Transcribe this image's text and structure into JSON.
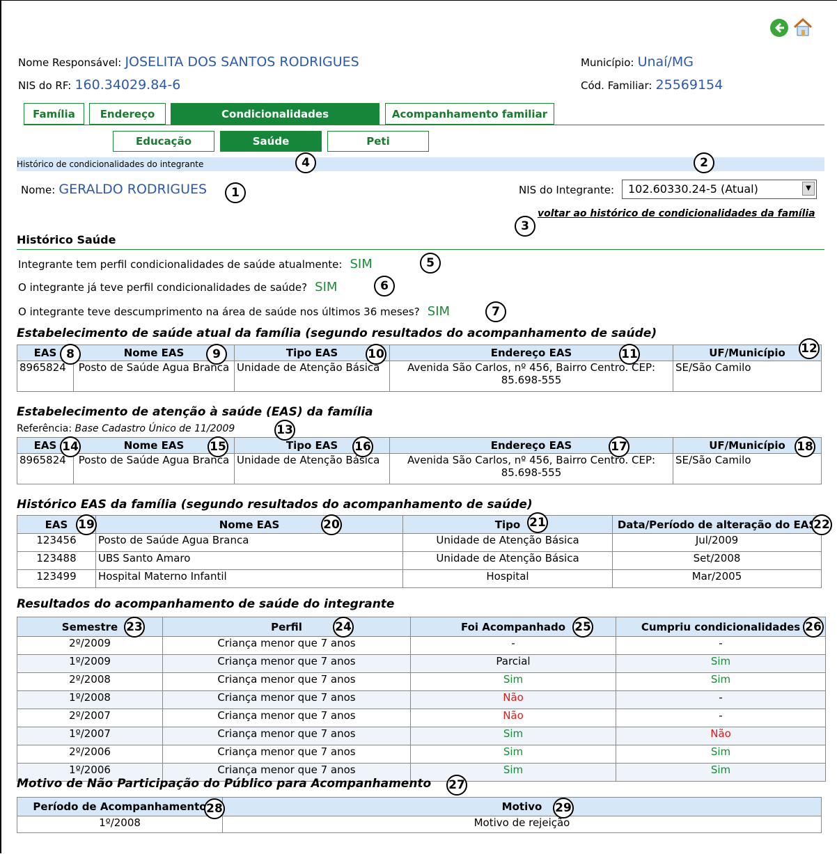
{
  "header": {
    "responsavel_label": "Nome Responsável:",
    "responsavel_value": "JOSELITA DOS SANTOS RODRIGUES",
    "nis_rf_label": "NIS do RF:",
    "nis_rf_value": "160.34029.84-6",
    "municipio_label": "Município:",
    "municipio_value": "Unaí/MG",
    "cod_familiar_label": "Cód. Familiar:",
    "cod_familiar_value": "25569154",
    "back_icon": "back-arrow-icon",
    "home_icon": "home-icon"
  },
  "tabs": [
    "Família",
    "Endereço",
    "Condicionalidades",
    "Acompanhamento familiar"
  ],
  "subtabs": [
    "Educação",
    "Saúde",
    "Peti"
  ],
  "section_bar": "Histórico de condicionalidades do integrante",
  "integrante": {
    "nome_label": "Nome:",
    "nome_value": "GERALDO RODRIGUES",
    "nis_label": "NIS do Integrante:",
    "nis_selected": "102.60330.24-5 (Atual)",
    "voltar_link": "voltar ao histórico de condicionalidades da família"
  },
  "historico": {
    "title": "Histórico Saúde",
    "q1": "Integrante tem perfil condicionalidades de saúde atualmente:",
    "a1": "SIM",
    "q2": "O integrante já teve perfil condicionalidades de saúde?",
    "a2": "SIM",
    "q3": "O integrante teve descumprimento na área de saúde nos últimos 36 meses?",
    "a3": "SIM"
  },
  "est_atual": {
    "title": "Estabelecimento de saúde atual da família (segundo resultados do acompanhamento de saúde)",
    "headers": [
      "EAS",
      "Nome EAS",
      "Tipo EAS",
      "Endereço EAS",
      "UF/Município"
    ],
    "row": [
      "8965824",
      "Posto de Saúde Agua Branca",
      "Unidade de Atenção Básica",
      "Avenida São Carlos, nº 456, Bairro Centro. CEP: 85.698-555",
      "SE/São Camilo"
    ]
  },
  "est_familia": {
    "title": "Estabelecimento de atenção à saúde (EAS) da família",
    "ref_label": "Referência:",
    "ref_value": "Base Cadastro Único de 11/2009",
    "headers": [
      "EAS",
      "Nome EAS",
      "Tipo EAS",
      "Endereço EAS",
      "UF/Município"
    ],
    "row": [
      "8965824",
      "Posto de Saúde Agua Branca",
      "Unidade de Atenção Básica",
      "Avenida São Carlos, nº 456, Bairro Centro. CEP: 85.698-555",
      "SE/São Camilo"
    ]
  },
  "hist_eas": {
    "title": "Histórico EAS da família (segundo resultados do acompanhamento de saúde)",
    "headers": [
      "EAS",
      "Nome EAS",
      "Tipo",
      "Data/Período de alteração do EAS"
    ],
    "rows": [
      [
        "123456",
        "Posto de Saúde Agua Branca",
        "Unidade de Atenção Básica",
        "Jul/2009"
      ],
      [
        "123488",
        "UBS Santo Amaro",
        "Unidade de Atenção Básica",
        "Set/2008"
      ],
      [
        "123499",
        "Hospital Materno Infantil",
        "Hospital",
        "Mar/2005"
      ]
    ]
  },
  "resultados": {
    "title": "Resultados do acompanhamento de saúde do integrante",
    "headers": [
      "Semestre",
      "Perfil",
      "Foi Acompanhado",
      "Cumpriu condicionalidades"
    ],
    "rows": [
      [
        "2º/2009",
        "Criança menor que 7 anos",
        "-",
        "-"
      ],
      [
        "1º/2009",
        "Criança menor que 7 anos",
        "Parcial",
        "Sim"
      ],
      [
        "2º/2008",
        "Criança menor que 7 anos",
        "Sim",
        "Sim"
      ],
      [
        "1º/2008",
        "Criança menor que 7 anos",
        "Não",
        "-"
      ],
      [
        "2º/2007",
        "Criança menor que 7 anos",
        "Não",
        "-"
      ],
      [
        "1º/2007",
        "Criança menor que 7 anos",
        "Sim",
        "Não"
      ],
      [
        "2º/2006",
        "Criança menor que 7 anos",
        "Sim",
        "Sim"
      ],
      [
        "1º/2006",
        "Criança menor que 7 anos",
        "Sim",
        "Sim"
      ]
    ]
  },
  "motivo": {
    "title": "Motivo de Não Participação do Público para Acompanhamento",
    "headers": [
      "Período de Acompanhamento",
      "Motivo"
    ],
    "rows": [
      [
        "1º/2008",
        "Motivo de rejeição"
      ]
    ]
  },
  "markers": [
    "1",
    "2",
    "3",
    "4",
    "5",
    "6",
    "7",
    "8",
    "9",
    "10",
    "11",
    "12",
    "13",
    "14",
    "15",
    "16",
    "17",
    "18",
    "19",
    "20",
    "21",
    "22",
    "23",
    "24",
    "25",
    "26",
    "27",
    "28",
    "29"
  ],
  "colors": {
    "green": "#1a8a35",
    "red": "#e21a1a",
    "blue": "#2b59b0",
    "header_bg": "#d6e8f7"
  }
}
